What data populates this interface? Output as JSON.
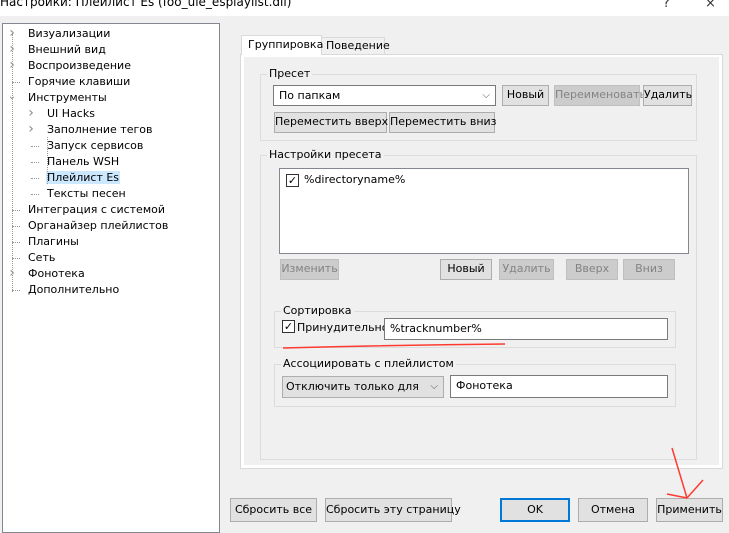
{
  "window": {
    "title": "Настройки: Плейлист Es (foo_uie_esplaylist.dll)",
    "help": "?",
    "close": "×"
  },
  "tree": [
    {
      "label": "Визуализации",
      "level": 0,
      "expander": "collapsed"
    },
    {
      "label": "Внешний вид",
      "level": 0,
      "expander": "collapsed"
    },
    {
      "label": "Воспроизведение",
      "level": 0,
      "expander": "collapsed"
    },
    {
      "label": "Горячие клавиши",
      "level": 0,
      "expander": "none"
    },
    {
      "label": "Инструменты",
      "level": 0,
      "expander": "expanded"
    },
    {
      "label": "UI Hacks",
      "level": 1,
      "expander": "collapsed"
    },
    {
      "label": "Заполнение тегов",
      "level": 1,
      "expander": "collapsed"
    },
    {
      "label": "Запуск сервисов",
      "level": 1,
      "expander": "none"
    },
    {
      "label": "Панель WSH",
      "level": 1,
      "expander": "none"
    },
    {
      "label": "Плейлист Es",
      "level": 1,
      "expander": "none",
      "selected": true
    },
    {
      "label": "Тексты песен",
      "level": 1,
      "expander": "none"
    },
    {
      "label": "Интеграция с системой",
      "level": 0,
      "expander": "none"
    },
    {
      "label": "Органайзер плейлистов",
      "level": 0,
      "expander": "none"
    },
    {
      "label": "Плагины",
      "level": 0,
      "expander": "none"
    },
    {
      "label": "Сеть",
      "level": 0,
      "expander": "none"
    },
    {
      "label": "Фонотека",
      "level": 0,
      "expander": "collapsed"
    },
    {
      "label": "Дополнительно",
      "level": 0,
      "expander": "none"
    }
  ],
  "tabs": [
    {
      "label": "Группировка",
      "active": true
    },
    {
      "label": "Поведение",
      "active": false
    }
  ],
  "preset": {
    "group_label": "Пресет",
    "selected": "По папкам",
    "new": "Новый",
    "rename": "Переименовать",
    "delete": "Удалить",
    "move_up": "Переместить вверх",
    "move_down": "Переместить вниз"
  },
  "preset_settings": {
    "group_label": "Настройки пресета",
    "items": [
      {
        "label": "%directoryname%",
        "checked": true
      }
    ],
    "edit": "Изменить",
    "new": "Новый",
    "delete": "Удалить",
    "up": "Вверх",
    "down": "Вниз"
  },
  "sorting": {
    "group_label": "Сортировка",
    "force_label": "Принудительно",
    "force_checked": true,
    "value": "%tracknumber%"
  },
  "associate": {
    "group_label": "Ассоциировать с плейлистом",
    "mode": "Отключить только для",
    "value": "Фонотека"
  },
  "footer": {
    "reset_all": "Сбросить все",
    "reset_page": "Сбросить эту страницу",
    "ok": "OK",
    "cancel": "Отмена",
    "apply": "Применить"
  },
  "annotation_color": "#ff3b2f",
  "accent_color": "#0078d7"
}
